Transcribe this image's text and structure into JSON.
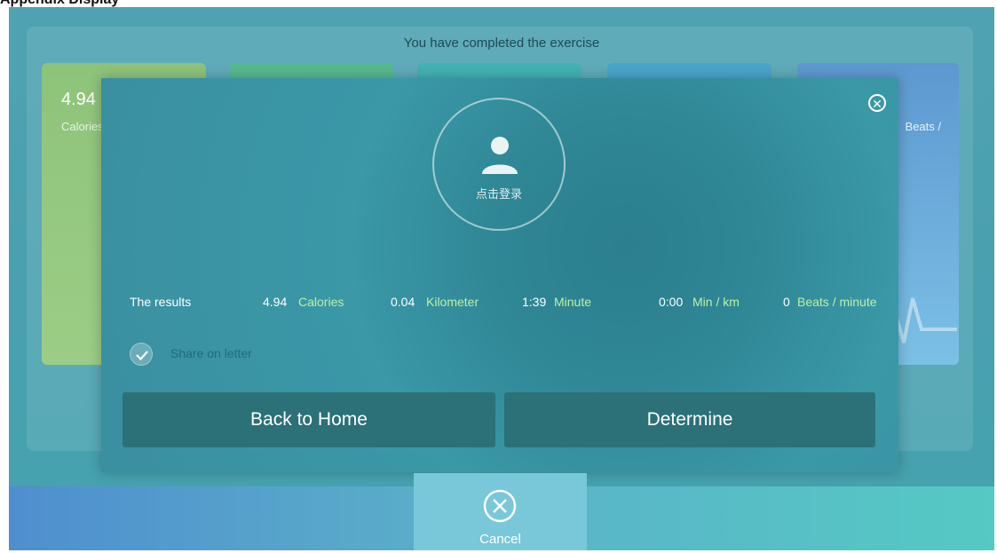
{
  "header_caption": "Appendix Display",
  "background": {
    "title": "You have completed the exercise",
    "cards": [
      {
        "value": "4.94",
        "unit": "Calories"
      },
      {
        "value": "",
        "unit": ""
      },
      {
        "value": "",
        "unit": ""
      },
      {
        "value": "",
        "unit": ""
      },
      {
        "value": "",
        "unit": "Beats /"
      }
    ]
  },
  "modal": {
    "avatar_label": "点击登录",
    "results": {
      "label": "The results",
      "items": [
        {
          "value": "4.94",
          "unit": "Calories"
        },
        {
          "value": "0.04",
          "unit": "Kilometer"
        },
        {
          "value": "1:39",
          "unit": "Minute"
        },
        {
          "value": "0:00",
          "unit": "Min / km"
        },
        {
          "value": "0",
          "unit": "Beats / minute"
        }
      ]
    },
    "share_label": "Share on letter",
    "share_checked": true,
    "back_home_label": "Back to Home",
    "determine_label": "Determine"
  },
  "bottom": {
    "cancel_label": "Cancel"
  },
  "colors": {
    "accent_green": "#bff0a6",
    "button_dark": "#2b7177"
  }
}
